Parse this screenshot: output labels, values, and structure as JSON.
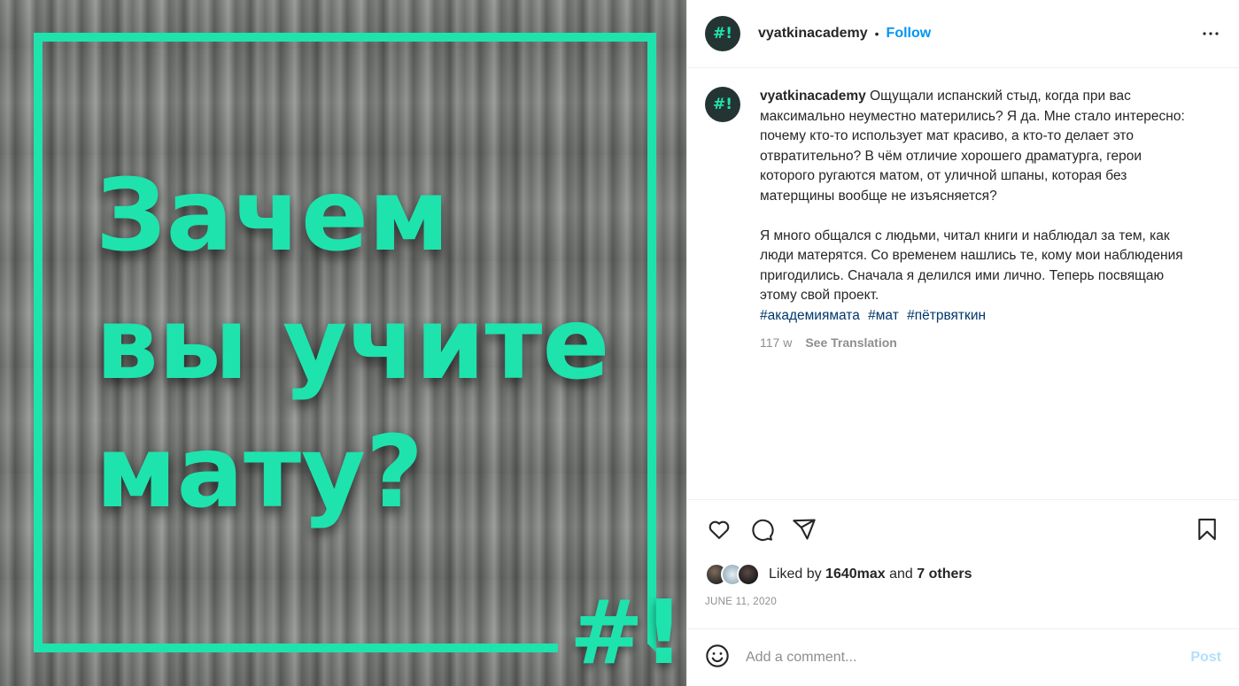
{
  "media": {
    "headline_lines": [
      "Зачем",
      "вы учите",
      "мату?"
    ],
    "logo_text": "#!",
    "accent_color": "#1ee3ad"
  },
  "header": {
    "avatar_text": "#!",
    "username": "vyatkinacademy",
    "separator": "•",
    "follow_label": "Follow",
    "more_icon": "more-horizontal-icon"
  },
  "caption": {
    "avatar_text": "#!",
    "username": "vyatkinacademy",
    "paragraph1": "Ощущали испанский стыд, когда при вас максимально неуместно матерились? Я да. Мне стало интересно: почему кто-то использует мат красиво, а кто-то делает это отвратительно? В чём отличие хорошего драматурга, герои которого ругаются матом, от уличной шпаны, которая без матерщины вообще не изъясняется?",
    "paragraph2": "Я много общался с людьми, читал книги и наблюдал за тем, как люди матерятся. Со временем нашлись те, кому мои наблюдения пригодились. Сначала я делился ими лично. Теперь посвящаю этому свой проект.",
    "hashtags": [
      "#академиямата",
      "#мат",
      "#пётрвяткин"
    ],
    "age": "117 w",
    "see_translation": "See Translation"
  },
  "actions": {
    "icons": [
      "heart-icon",
      "comment-icon",
      "share-icon",
      "bookmark-icon"
    ]
  },
  "likes": {
    "prefix": "Liked by",
    "user": "1640max",
    "and": "and",
    "others": "7 others"
  },
  "date": "JUNE 11, 2020",
  "comment": {
    "placeholder": "Add a comment...",
    "post_label": "Post",
    "emoji_icon": "emoji-icon"
  }
}
